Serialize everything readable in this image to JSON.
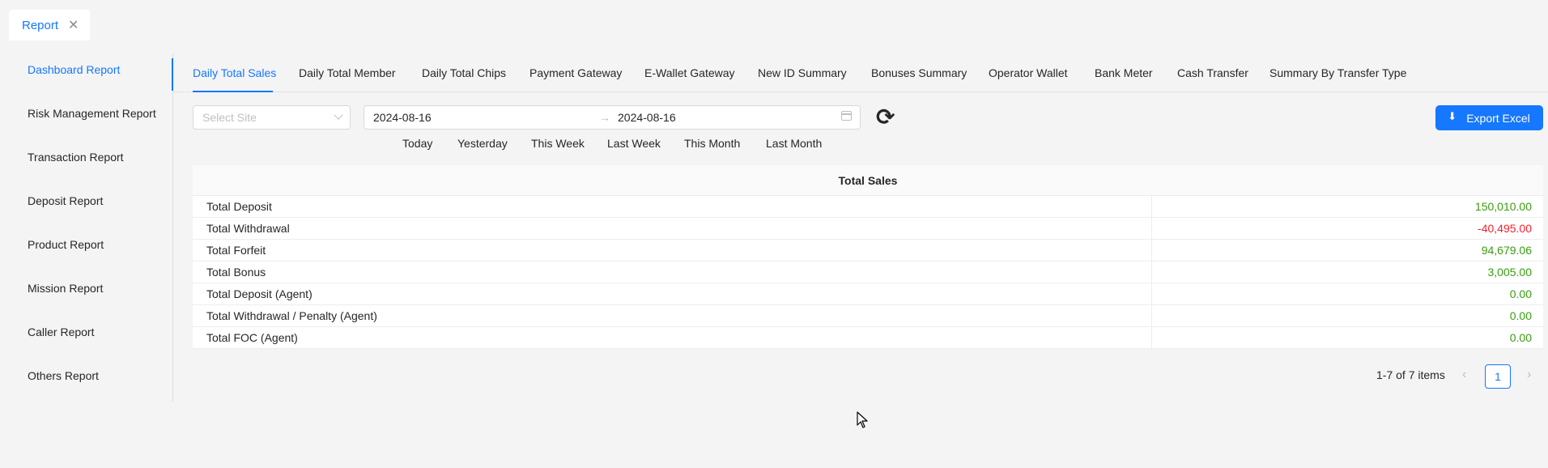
{
  "top_tab": {
    "label": "Report",
    "close": "✕"
  },
  "sidebar": {
    "items": [
      {
        "label": "Dashboard Report",
        "active": true
      },
      {
        "label": "Risk Management Report"
      },
      {
        "label": "Transaction Report"
      },
      {
        "label": "Deposit Report"
      },
      {
        "label": "Product Report"
      },
      {
        "label": "Mission Report"
      },
      {
        "label": "Caller Report"
      },
      {
        "label": "Others Report"
      }
    ]
  },
  "tabs": [
    {
      "label": "Daily Total Sales",
      "active": true
    },
    {
      "label": "Daily Total Member"
    },
    {
      "label": "Daily Total Chips"
    },
    {
      "label": "Payment Gateway"
    },
    {
      "label": "E-Wallet Gateway"
    },
    {
      "label": "New ID Summary"
    },
    {
      "label": "Bonuses Summary"
    },
    {
      "label": "Operator Wallet"
    },
    {
      "label": "Bank Meter"
    },
    {
      "label": "Cash Transfer"
    },
    {
      "label": "Summary By Transfer Type"
    }
  ],
  "filters": {
    "site_placeholder": "Select Site",
    "date_from": "2024-08-16",
    "date_separator": "→",
    "date_to": "2024-08-16",
    "refresh_icon": "⟳",
    "presets": [
      "Today",
      "Yesterday",
      "This Week",
      "Last Week",
      "This Month",
      "Last Month"
    ]
  },
  "export_label": "Export Excel",
  "table": {
    "header": "Total Sales",
    "rows": [
      {
        "label": "Total Deposit",
        "value": "150,010.00",
        "color": "#389e0d"
      },
      {
        "label": "Total Withdrawal",
        "value": "-40,495.00",
        "color": "#f5222d"
      },
      {
        "label": "Total Forfeit",
        "value": "94,679.06",
        "color": "#389e0d"
      },
      {
        "label": "Total Bonus",
        "value": "3,005.00",
        "color": "#389e0d"
      },
      {
        "label": "Total Deposit (Agent)",
        "value": "0.00",
        "color": "#389e0d"
      },
      {
        "label": "Total Withdrawal / Penalty (Agent)",
        "value": "0.00",
        "color": "#389e0d"
      },
      {
        "label": "Total FOC (Agent)",
        "value": "0.00",
        "color": "#389e0d"
      }
    ]
  },
  "pagination": {
    "summary": "1-7 of 7 items",
    "current": "1",
    "prev": "‹",
    "next": "›"
  },
  "colors": {
    "accent": "#1677ff",
    "positive": "#389e0d",
    "negative": "#f5222d"
  }
}
